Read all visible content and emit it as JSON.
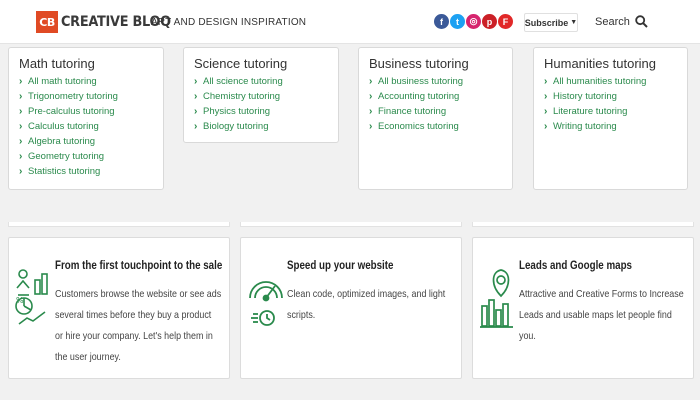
{
  "header": {
    "logo_badge": "CB",
    "logo_text": "CREATIVE BLOQ",
    "tagline": "ART AND DESIGN INSPIRATION",
    "socials": [
      {
        "name": "facebook-icon",
        "glyph": "f",
        "color": "#3b5998"
      },
      {
        "name": "twitter-icon",
        "glyph": "t",
        "color": "#1da1f2"
      },
      {
        "name": "instagram-icon",
        "glyph": "◎",
        "color": "#d6246e"
      },
      {
        "name": "pinterest-icon",
        "glyph": "p",
        "color": "#cb2027"
      },
      {
        "name": "flipboard-icon",
        "glyph": "F",
        "color": "#e12828"
      }
    ],
    "subscribe_label": "Subscribe",
    "search_label": "Search"
  },
  "tutoring": [
    {
      "title": "Math tutoring",
      "links": [
        "All math tutoring",
        "Trigonometry tutoring",
        "Pre-calculus tutoring",
        "Calculus tutoring",
        "Algebra tutoring",
        "Geometry tutoring",
        "Statistics tutoring"
      ]
    },
    {
      "title": "Science tutoring",
      "links": [
        "All science tutoring",
        "Chemistry tutoring",
        "Physics tutoring",
        "Biology tutoring"
      ]
    },
    {
      "title": "Business tutoring",
      "links": [
        "All business tutoring",
        "Accounting tutoring",
        "Finance tutoring",
        "Economics tutoring"
      ]
    },
    {
      "title": "Humanities tutoring",
      "links": [
        "All humanities tutoring",
        "History tutoring",
        "Literature tutoring",
        "Writing tutoring"
      ]
    }
  ],
  "features": [
    {
      "title": "From the first touchpoint to the sale",
      "body": "Customers browse the website or see ads several times before they buy a product or hire your company. Let's help them in the user journey.",
      "icon": "analytics-icon"
    },
    {
      "title": "Speed up your website",
      "body": "Clean code, optimized images, and light scripts.",
      "icon": "speedometer-icon"
    },
    {
      "title": "Leads and Google maps",
      "body": "Attractive and Creative Forms to Increase Leads and usable maps let people find you.",
      "icon": "map-pin-chart-icon"
    }
  ],
  "colors": {
    "accent_green": "#2a8a4c",
    "brand_orange": "#e04a24"
  }
}
